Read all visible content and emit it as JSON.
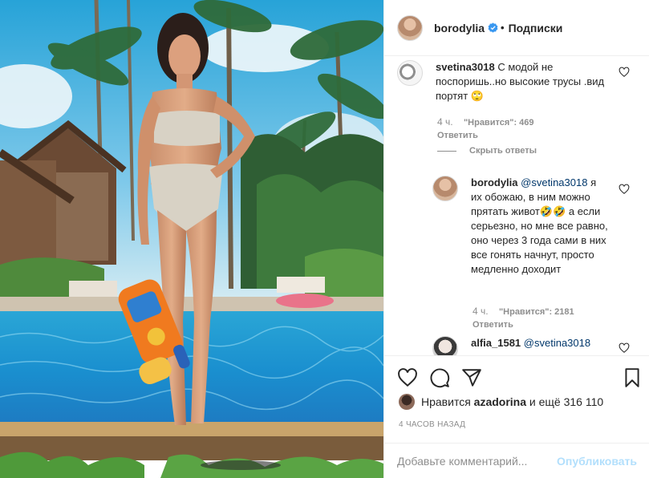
{
  "post": {
    "author": "borodylia",
    "follow_label": "Подписки",
    "dot": "•"
  },
  "comments": [
    {
      "user": "svetina3018",
      "text": "С модой не поспоришь..но высокие трусы .вид портят 🙄",
      "time": "4 ч.",
      "likes": "\"Нравится\": 469",
      "reply_label": "Ответить"
    }
  ],
  "hide_replies_label": "Скрыть ответы",
  "reply": {
    "user": "borodylia",
    "mention": "@svetina3018",
    "text": " я их обожаю, в ним можно прятать живот🤣🤣 а если серьезно, но мне все равно, оно через 3 года сами в них все гонять начнут, просто медленно доходит",
    "time": "4 ч.",
    "likes": "\"Нравится\": 2181",
    "reply_label": "Ответить"
  },
  "partial_comment": {
    "user": "alfia_1581",
    "mention": "@svetina3018"
  },
  "likes_summary": {
    "prefix": "Нравится",
    "user": "azadorina",
    "suffix": "и ещё 316 110"
  },
  "timestamp": "4 ЧАСОВ НАЗАД",
  "add_comment": {
    "placeholder": "Добавьте комментарий...",
    "publish_label": "Опубликовать"
  },
  "icons": {
    "like": "heart-icon",
    "comment": "comment-icon",
    "share": "share-icon",
    "save": "bookmark-icon",
    "verified": "verified-badge-icon"
  },
  "colors": {
    "link": "#00376b",
    "verified": "#3897f0",
    "publish_disabled": "#b2dffc",
    "muted": "#8e8e8e"
  }
}
